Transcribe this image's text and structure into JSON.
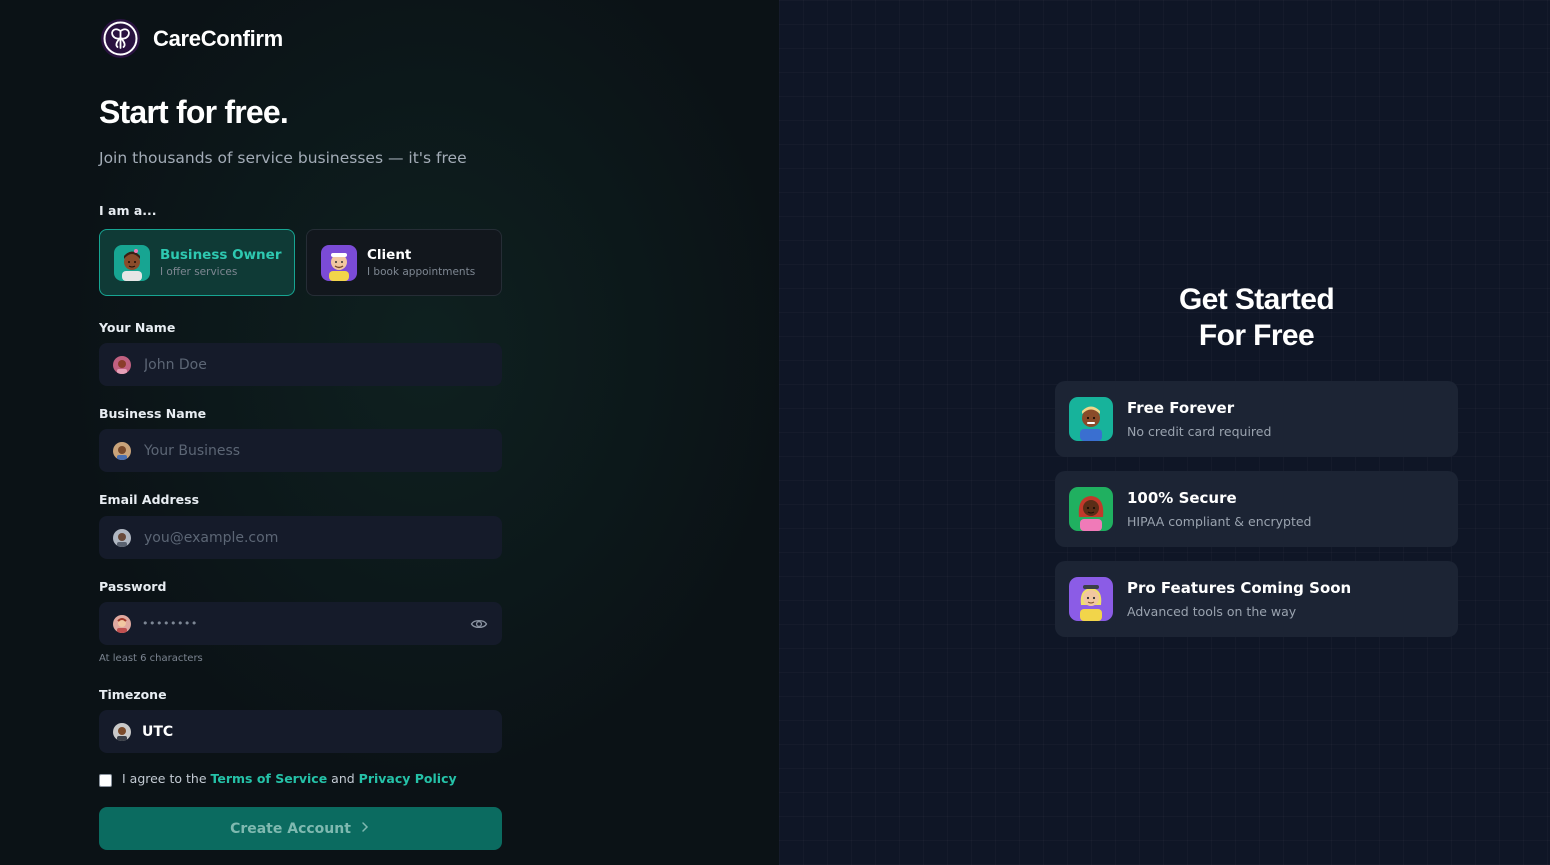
{
  "brand": {
    "name": "CareConfirm",
    "logo_icon": "butterfly-logo-icon",
    "logo_bg": "#2a1240"
  },
  "signup": {
    "title": "Start for free.",
    "subtitle": "Join thousands of service businesses — it's free",
    "role_label": "I am a...",
    "roles": [
      {
        "title": "Business Owner",
        "subtitle": "I offer services",
        "selected": true,
        "avatar_icon": "business-owner-avatar-icon"
      },
      {
        "title": "Client",
        "subtitle": "I book appointments",
        "selected": false,
        "avatar_icon": "client-avatar-icon"
      }
    ],
    "fields": {
      "name": {
        "label": "Your Name",
        "placeholder": "John Doe"
      },
      "business": {
        "label": "Business Name",
        "placeholder": "Your Business"
      },
      "email": {
        "label": "Email Address",
        "placeholder": "you@example.com"
      },
      "password": {
        "label": "Password",
        "value": "••••••••",
        "hint": "At least 6 characters"
      },
      "timezone": {
        "label": "Timezone",
        "value": "UTC"
      }
    },
    "agree": {
      "prefix": "I agree to the",
      "terms": "Terms of Service",
      "and": "and",
      "privacy": "Privacy Policy",
      "checked": false
    },
    "submit_label": "Create Account"
  },
  "promo": {
    "title_line1": "Get Started",
    "title_line2": "For Free",
    "features": [
      {
        "title": "Free Forever",
        "subtitle": "No credit card required",
        "avatar_icon": "teal-person-avatar-icon"
      },
      {
        "title": "100% Secure",
        "subtitle": "HIPAA compliant & encrypted",
        "avatar_icon": "green-person-avatar-icon"
      },
      {
        "title": "Pro Features Coming Soon",
        "subtitle": "Advanced tools on the way",
        "avatar_icon": "purple-person-avatar-icon"
      }
    ]
  },
  "colors": {
    "accent": "#25c2a8",
    "button_bg": "#0b6b60",
    "field_bg": "#151b2a",
    "card_bg": "#1c2434"
  }
}
